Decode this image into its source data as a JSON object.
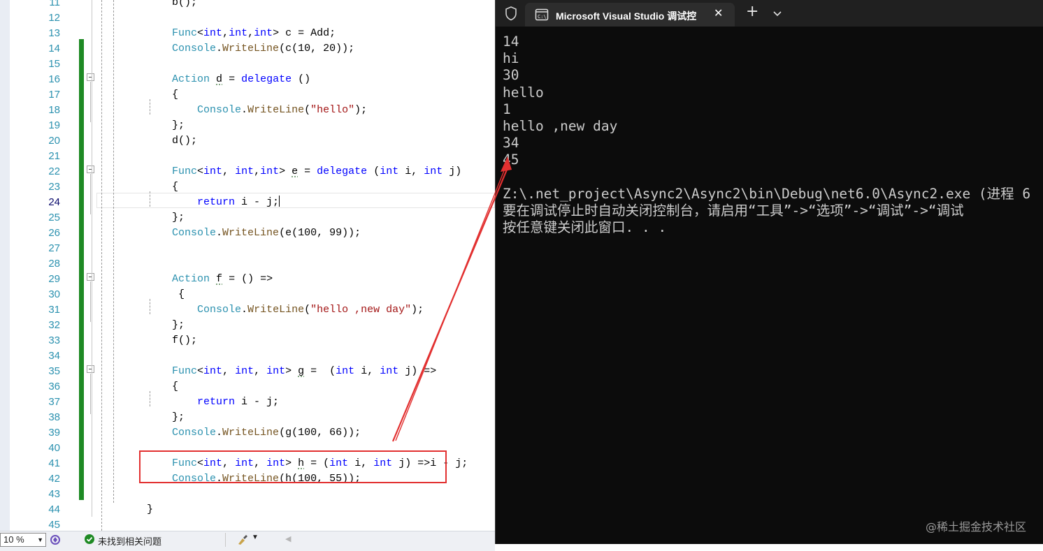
{
  "editor": {
    "lines": [
      {
        "n": "11",
        "code": [
          {
            "t": "        b();"
          }
        ]
      },
      {
        "n": "12",
        "code": []
      },
      {
        "n": "13",
        "code": [
          {
            "t": "        "
          },
          {
            "t": "Func",
            "c": "ty"
          },
          {
            "t": "<"
          },
          {
            "t": "int",
            "c": "kw"
          },
          {
            "t": ","
          },
          {
            "t": "int",
            "c": "kw"
          },
          {
            "t": ","
          },
          {
            "t": "int",
            "c": "kw"
          },
          {
            "t": "> c = Add;"
          }
        ]
      },
      {
        "n": "14",
        "code": [
          {
            "t": "        "
          },
          {
            "t": "Console",
            "c": "ty"
          },
          {
            "t": "."
          },
          {
            "t": "WriteLine",
            "c": "mt"
          },
          {
            "t": "(c(10, 20));"
          }
        ]
      },
      {
        "n": "15",
        "code": []
      },
      {
        "n": "16",
        "code": [
          {
            "t": "        "
          },
          {
            "t": "Action",
            "c": "ty"
          },
          {
            "t": " "
          },
          {
            "t": "d",
            "c": "sq"
          },
          {
            "t": " = "
          },
          {
            "t": "delegate",
            "c": "kw"
          },
          {
            "t": " ()"
          }
        ]
      },
      {
        "n": "17",
        "code": [
          {
            "t": "        {"
          }
        ]
      },
      {
        "n": "18",
        "code": [
          {
            "t": "            "
          },
          {
            "t": "Console",
            "c": "ty"
          },
          {
            "t": "."
          },
          {
            "t": "WriteLine",
            "c": "mt"
          },
          {
            "t": "("
          },
          {
            "t": "\"hello\"",
            "c": "st"
          },
          {
            "t": ");"
          }
        ]
      },
      {
        "n": "19",
        "code": [
          {
            "t": "        };"
          }
        ]
      },
      {
        "n": "20",
        "code": [
          {
            "t": "        d();"
          }
        ]
      },
      {
        "n": "21",
        "code": []
      },
      {
        "n": "22",
        "code": [
          {
            "t": "        "
          },
          {
            "t": "Func",
            "c": "ty"
          },
          {
            "t": "<"
          },
          {
            "t": "int",
            "c": "kw"
          },
          {
            "t": ", "
          },
          {
            "t": "int",
            "c": "kw"
          },
          {
            "t": ","
          },
          {
            "t": "int",
            "c": "kw"
          },
          {
            "t": "> "
          },
          {
            "t": "e",
            "c": "sq"
          },
          {
            "t": " = "
          },
          {
            "t": "delegate",
            "c": "kw"
          },
          {
            "t": " ("
          },
          {
            "t": "int",
            "c": "kw"
          },
          {
            "t": " i, "
          },
          {
            "t": "int",
            "c": "kw"
          },
          {
            "t": " j)"
          }
        ]
      },
      {
        "n": "23",
        "code": [
          {
            "t": "        {"
          }
        ]
      },
      {
        "n": "24",
        "code": [
          {
            "t": "            "
          },
          {
            "t": "return",
            "c": "kw"
          },
          {
            "t": " i - j;"
          }
        ],
        "current": true
      },
      {
        "n": "25",
        "code": [
          {
            "t": "        };"
          }
        ]
      },
      {
        "n": "26",
        "code": [
          {
            "t": "        "
          },
          {
            "t": "Console",
            "c": "ty"
          },
          {
            "t": "."
          },
          {
            "t": "WriteLine",
            "c": "mt"
          },
          {
            "t": "(e(100, 99));"
          }
        ]
      },
      {
        "n": "27",
        "code": []
      },
      {
        "n": "28",
        "code": []
      },
      {
        "n": "29",
        "code": [
          {
            "t": "        "
          },
          {
            "t": "Action",
            "c": "ty"
          },
          {
            "t": " "
          },
          {
            "t": "f",
            "c": "sq"
          },
          {
            "t": " = () =>"
          }
        ]
      },
      {
        "n": "30",
        "code": [
          {
            "t": "         {"
          }
        ]
      },
      {
        "n": "31",
        "code": [
          {
            "t": "            "
          },
          {
            "t": "Console",
            "c": "ty"
          },
          {
            "t": "."
          },
          {
            "t": "WriteLine",
            "c": "mt"
          },
          {
            "t": "("
          },
          {
            "t": "\"hello ,new day\"",
            "c": "st"
          },
          {
            "t": ");"
          }
        ]
      },
      {
        "n": "32",
        "code": [
          {
            "t": "        };"
          }
        ]
      },
      {
        "n": "33",
        "code": [
          {
            "t": "        f();"
          }
        ]
      },
      {
        "n": "34",
        "code": []
      },
      {
        "n": "35",
        "code": [
          {
            "t": "        "
          },
          {
            "t": "Func",
            "c": "ty"
          },
          {
            "t": "<"
          },
          {
            "t": "int",
            "c": "kw"
          },
          {
            "t": ", "
          },
          {
            "t": "int",
            "c": "kw"
          },
          {
            "t": ", "
          },
          {
            "t": "int",
            "c": "kw"
          },
          {
            "t": "> "
          },
          {
            "t": "g",
            "c": "sq"
          },
          {
            "t": " =  ("
          },
          {
            "t": "int",
            "c": "kw"
          },
          {
            "t": " i, "
          },
          {
            "t": "int",
            "c": "kw"
          },
          {
            "t": " j) =>"
          }
        ]
      },
      {
        "n": "36",
        "code": [
          {
            "t": "        {"
          }
        ]
      },
      {
        "n": "37",
        "code": [
          {
            "t": "            "
          },
          {
            "t": "return",
            "c": "kw"
          },
          {
            "t": " i - j;"
          }
        ]
      },
      {
        "n": "38",
        "code": [
          {
            "t": "        };"
          }
        ]
      },
      {
        "n": "39",
        "code": [
          {
            "t": "        "
          },
          {
            "t": "Console",
            "c": "ty"
          },
          {
            "t": "."
          },
          {
            "t": "WriteLine",
            "c": "mt"
          },
          {
            "t": "(g(100, 66));"
          }
        ]
      },
      {
        "n": "40",
        "code": []
      },
      {
        "n": "41",
        "code": [
          {
            "t": "        "
          },
          {
            "t": "Func",
            "c": "ty"
          },
          {
            "t": "<"
          },
          {
            "t": "int",
            "c": "kw"
          },
          {
            "t": ", "
          },
          {
            "t": "int",
            "c": "kw"
          },
          {
            "t": ", "
          },
          {
            "t": "int",
            "c": "kw"
          },
          {
            "t": "> "
          },
          {
            "t": "h",
            "c": "sq"
          },
          {
            "t": " = ("
          },
          {
            "t": "int",
            "c": "kw"
          },
          {
            "t": " i, "
          },
          {
            "t": "int",
            "c": "kw"
          },
          {
            "t": " j) =>i - j;"
          }
        ]
      },
      {
        "n": "42",
        "code": [
          {
            "t": "        "
          },
          {
            "t": "Console",
            "c": "ty"
          },
          {
            "t": "."
          },
          {
            "t": "WriteLine",
            "c": "mt"
          },
          {
            "t": "(h(100, 55));"
          }
        ]
      },
      {
        "n": "43",
        "code": []
      },
      {
        "n": "44",
        "code": [
          {
            "t": "    }"
          }
        ]
      },
      {
        "n": "45",
        "code": []
      }
    ]
  },
  "statusbar": {
    "zoom": "10 %",
    "issues_text": "未找到相关问题"
  },
  "terminal": {
    "tab_title": "Microsoft Visual Studio 调试控",
    "output_lines": [
      "14",
      "hi",
      "30",
      "hello",
      "1",
      "hello ,new day",
      "34",
      "45",
      "",
      "Z:\\.net_project\\Async2\\Async2\\bin\\Debug\\net6.0\\Async2.exe (进程 6",
      "要在调试停止时自动关闭控制台，请启用“工具”->“选项”->“调试”->“调试",
      "按任意键关闭此窗口. . ."
    ],
    "watermark": "@稀土掘金技术社区"
  },
  "colors": {
    "keyword": "#0000ff",
    "type": "#2b91af",
    "string": "#a31515",
    "change_bar": "#1e8a24",
    "annotation": "#e23030",
    "terminal_bg": "#0c0c0c"
  }
}
